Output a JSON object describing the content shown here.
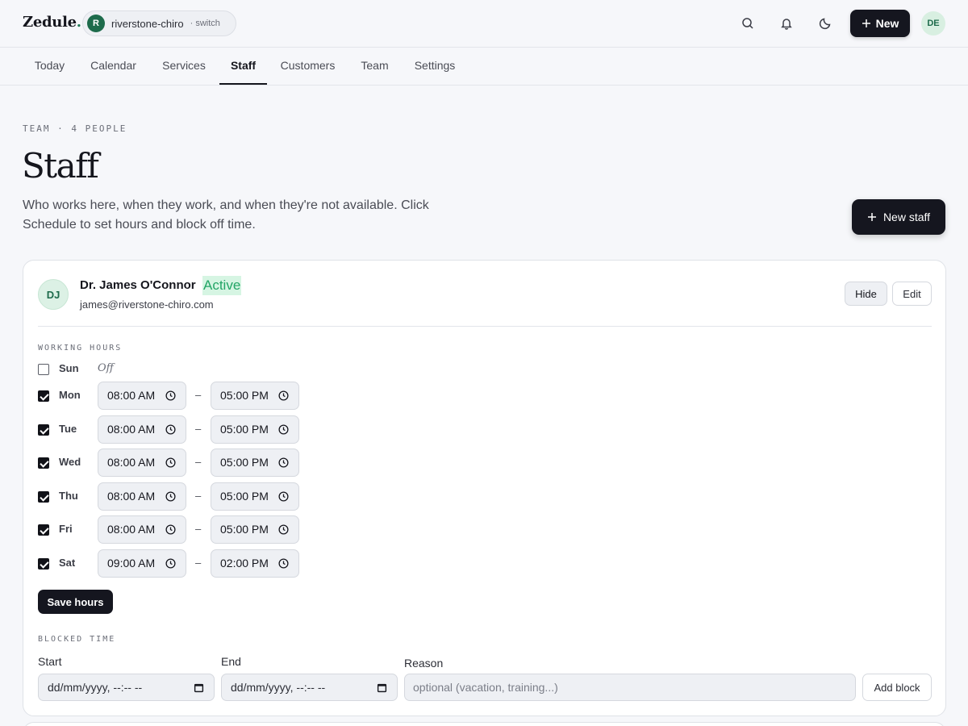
{
  "app": {
    "logo_text": "Zedule",
    "logo_dot": ".",
    "workspace_initial": "R",
    "workspace_name": "riverstone-chiro",
    "workspace_switch": "· switch",
    "new_label": "New",
    "user_initials": "DE",
    "icons": [
      "search-icon",
      "bell-icon",
      "moon-icon",
      "plus-icon"
    ]
  },
  "nav": {
    "tabs": [
      "Today",
      "Calendar",
      "Services",
      "Staff",
      "Customers",
      "Team",
      "Settings"
    ],
    "active": "Staff"
  },
  "header": {
    "eyebrow": "TEAM · 4 PEOPLE",
    "title": "Staff",
    "subtitle": "Who works here, when they work, and when they're not available. Click Schedule to set hours and block off time.",
    "new_staff_label": "New staff"
  },
  "staff": {
    "initials": "DJ",
    "name": "Dr. James O'Connor",
    "status": "Active",
    "email": "james@riverstone-chiro.com",
    "hide_label": "Hide",
    "edit_label": "Edit",
    "working_hours_label": "WORKING HOURS",
    "off_label": "Off",
    "days": [
      {
        "day": "Sun",
        "enabled": false,
        "from": "",
        "to": ""
      },
      {
        "day": "Mon",
        "enabled": true,
        "from": "08:00 AM",
        "to": "05:00 PM"
      },
      {
        "day": "Tue",
        "enabled": true,
        "from": "08:00 AM",
        "to": "05:00 PM"
      },
      {
        "day": "Wed",
        "enabled": true,
        "from": "08:00 AM",
        "to": "05:00 PM"
      },
      {
        "day": "Thu",
        "enabled": true,
        "from": "08:00 AM",
        "to": "05:00 PM"
      },
      {
        "day": "Fri",
        "enabled": true,
        "from": "08:00 AM",
        "to": "05:00 PM"
      },
      {
        "day": "Sat",
        "enabled": true,
        "from": "09:00 AM",
        "to": "02:00 PM"
      }
    ],
    "save_hours_label": "Save hours",
    "blocked": {
      "label": "BLOCKED TIME",
      "start_label": "Start",
      "end_label": "End",
      "reason_label": "Reason",
      "start_value": "dd/mm/yyyy, --:-- --",
      "end_value": "dd/mm/yyyy, --:-- --",
      "reason_placeholder": "optional (vacation, training...)",
      "add_block_label": "Add block"
    }
  }
}
